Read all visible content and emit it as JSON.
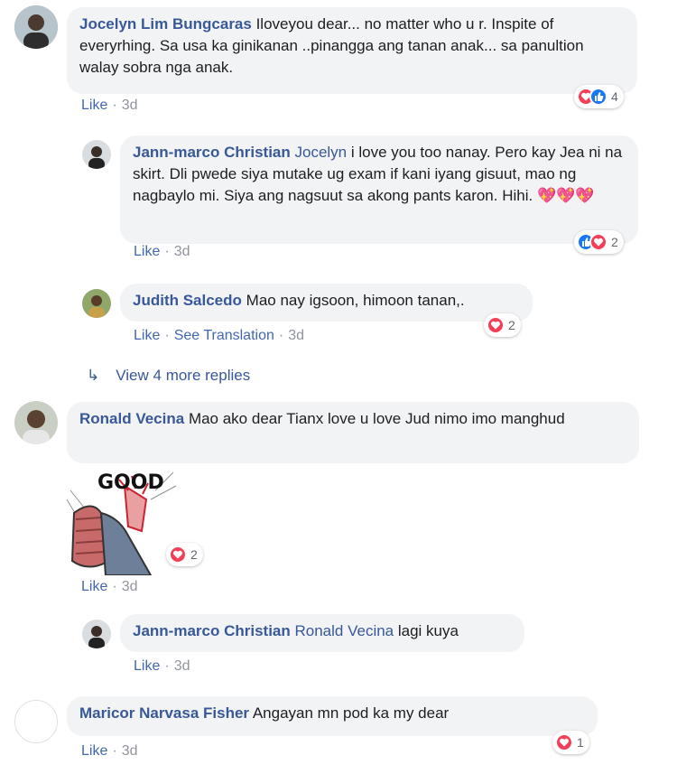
{
  "comments": [
    {
      "author": "Jocelyn Lim Bungcaras",
      "text": "Iloveyou dear... no matter who u r. Inspite of everyrhing. Sa usa ka ginikanan ..pinangga ang tanan anak... sa panultion walay sobra nga anak.",
      "like_label": "Like",
      "time": "3d",
      "reactions": [
        "love",
        "like"
      ],
      "reaction_count": "4"
    },
    {
      "author": "Jann-marco Christian",
      "mention": "Jocelyn",
      "text": "i love you too nanay. Pero kay Jea ni na skirt. Dli pwede siya mutake ug exam if kani iyang gisuut, mao ng nagbaylo mi. Siya ang nagsuut sa akong pants karon. Hihi. 💖💖💖",
      "like_label": "Like",
      "time": "3d",
      "reactions": [
        "like",
        "love"
      ],
      "reaction_count": "2"
    },
    {
      "author": "Judith Salcedo",
      "text": "Mao nay igsoon, himoon tanan,.",
      "like_label": "Like",
      "see_translation": "See Translation",
      "time": "3d",
      "reactions": [
        "love"
      ],
      "reaction_count": "2"
    },
    {
      "more_replies": "View 4 more replies"
    },
    {
      "author": "Ronald Vecina",
      "text": "Mao ako dear Tianx love u love Jud nimo imo manghud",
      "sticker_text": "GOOD",
      "like_label": "Like",
      "time": "3d",
      "reactions": [
        "love"
      ],
      "reaction_count": "2"
    },
    {
      "author": "Jann-marco Christian",
      "mention": "Ronald Vecina",
      "text": "lagi kuya",
      "like_label": "Like",
      "time": "3d"
    },
    {
      "author": "Maricor Narvasa Fisher",
      "text": "Angayan mn pod ka my dear",
      "like_label": "Like",
      "time": "3d",
      "reactions": [
        "love"
      ],
      "reaction_count": "1"
    }
  ],
  "colors": {
    "author": "#385898",
    "bubble": "#f2f3f5",
    "love": "#f33e58",
    "like": "#1877f2"
  }
}
